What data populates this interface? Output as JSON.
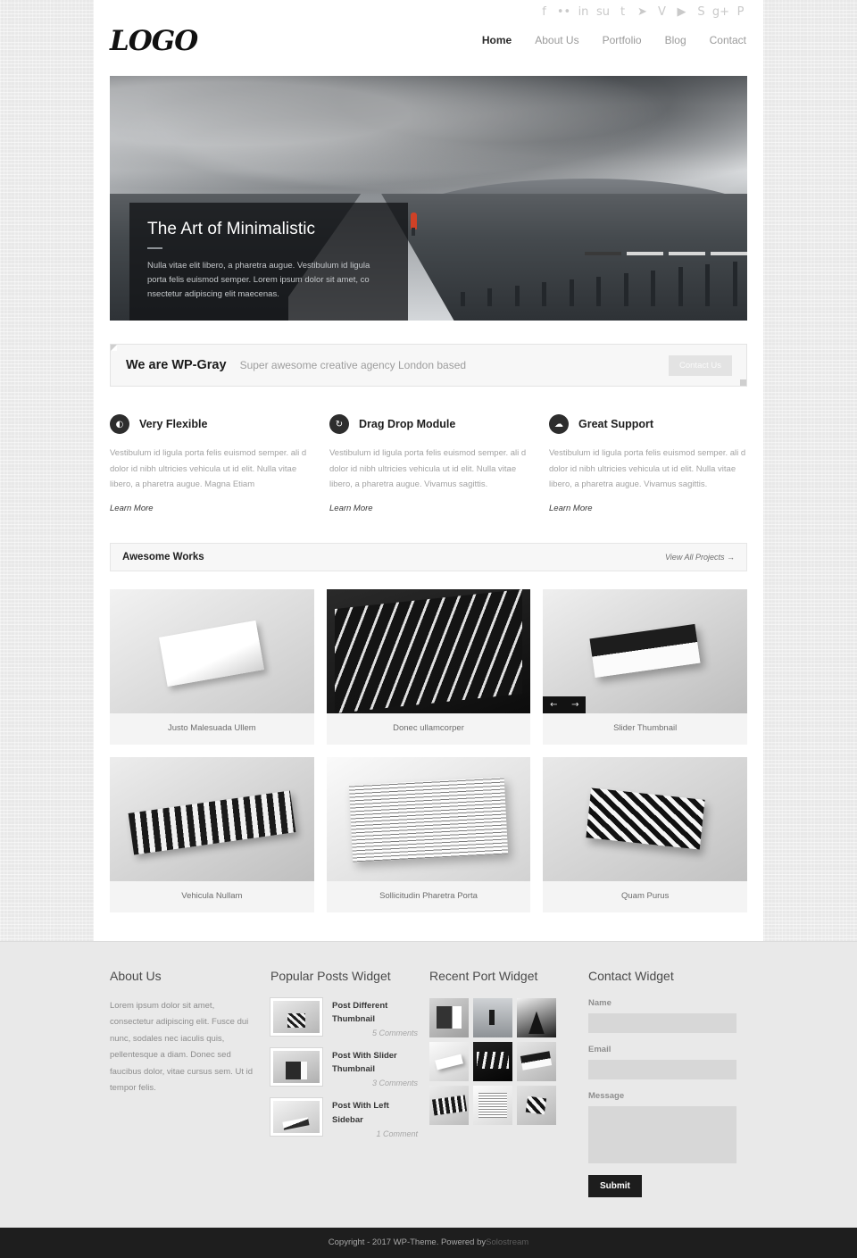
{
  "header": {
    "logo": "LOGO",
    "social": [
      {
        "name": "facebook-icon",
        "glyph": "f"
      },
      {
        "name": "flickr-icon",
        "glyph": "••"
      },
      {
        "name": "linkedin-icon",
        "glyph": "in"
      },
      {
        "name": "stumbleupon-icon",
        "glyph": "su"
      },
      {
        "name": "tumblr-icon",
        "glyph": "t"
      },
      {
        "name": "twitter-icon",
        "glyph": "➤"
      },
      {
        "name": "vimeo-icon",
        "glyph": "V"
      },
      {
        "name": "youtube-icon",
        "glyph": "▶"
      },
      {
        "name": "skype-icon",
        "glyph": "S"
      },
      {
        "name": "googleplus-icon",
        "glyph": "g+"
      },
      {
        "name": "pinterest-icon",
        "glyph": "P"
      }
    ],
    "nav": [
      {
        "label": "Home",
        "active": true
      },
      {
        "label": "About Us",
        "active": false
      },
      {
        "label": "Portfolio",
        "active": false
      },
      {
        "label": "Blog",
        "active": false
      },
      {
        "label": "Contact",
        "active": false
      }
    ]
  },
  "hero": {
    "title": "The Art of Minimalistic",
    "body": "Nulla vitae elit libero, a pharetra augue. Vestibulum id ligula porta felis euismod semper. Lorem ipsum dolor sit amet, co nsectetur adipiscing elit maecenas.",
    "slides": 4,
    "active_slide": 1
  },
  "callout": {
    "title": "We are WP-Gray",
    "subtitle": "Super awesome creative agency London based",
    "button": "Contact Us"
  },
  "features": [
    {
      "icon": "contrast-icon",
      "glyph": "◐",
      "title": "Very Flexible",
      "body": "Vestibulum id ligula porta felis euismod semper. ali d dolor id nibh ultricies vehicula ut id elit. Nulla vitae libero, a pharetra augue. Magna Etiam",
      "link": "Learn More"
    },
    {
      "icon": "refresh-icon",
      "glyph": "↻",
      "title": "Drag Drop Module",
      "body": "Vestibulum id ligula porta felis euismod semper. ali d dolor id nibh ultricies vehicula ut id elit. Nulla vitae libero, a pharetra augue. Vivamus sagittis.",
      "link": "Learn More"
    },
    {
      "icon": "cloud-icon",
      "glyph": "☁",
      "title": "Great Support",
      "body": "Vestibulum id ligula porta felis euismod semper. ali d dolor id nibh ultricies vehicula ut id elit. Nulla vitae libero, a pharetra augue. Vivamus sagittis.",
      "link": "Learn More"
    }
  ],
  "works": {
    "title": "Awesome Works",
    "view_all": "View All Projects →",
    "items": [
      {
        "caption": "Justo Malesuada Ullem",
        "art": "t1",
        "has_arrows": false
      },
      {
        "caption": "Donec ullamcorper",
        "art": "t2",
        "has_arrows": false
      },
      {
        "caption": "Slider Thumbnail",
        "art": "t3",
        "has_arrows": true
      },
      {
        "caption": "Vehicula Nullam",
        "art": "t4",
        "has_arrows": false
      },
      {
        "caption": "Sollicitudin Pharetra Porta",
        "art": "t5",
        "has_arrows": false
      },
      {
        "caption": "Quam Purus",
        "art": "t6",
        "has_arrows": false
      }
    ],
    "arrow_prev": "←",
    "arrow_next": "→"
  },
  "footer": {
    "about": {
      "title": "About Us",
      "body": "Lorem ipsum dolor sit amet, consectetur adipiscing elit. Fusce dui nunc, sodales nec iaculis quis, pellentesque a diam. Donec sed faucibus dolor, vitae cursus sem. Ut id tempor felis."
    },
    "popular_posts": {
      "title": "Popular Posts Widget",
      "items": [
        {
          "title": "Post Different Thumbnail",
          "comments": "5 Comments",
          "art": "pt1"
        },
        {
          "title": "Post With Slider Thumbnail",
          "comments": "3 Comments",
          "art": "pt2"
        },
        {
          "title": "Post With Left Sidebar",
          "comments": "1 Comment",
          "art": "pt3"
        }
      ]
    },
    "recent_port": {
      "title": "Recent Port Widget",
      "cells": [
        "g1",
        "g2",
        "g3",
        "g4",
        "g5",
        "g6",
        "g7",
        "g8",
        "g9"
      ]
    },
    "contact": {
      "title": "Contact Widget",
      "name_label": "Name",
      "name_value": "",
      "name_placeholder": "",
      "email_label": "Email",
      "email_value": "",
      "email_placeholder": "",
      "message_label": "Message",
      "message_value": "",
      "message_placeholder": "",
      "submit": "Submit"
    }
  },
  "copyright": {
    "text": "Copyright - 2017 WP-Theme. Powered by ",
    "link": "Solostream"
  },
  "colors": {
    "accent": "#1d1d1d",
    "page_bg": "#e8e8e8",
    "footer_bg": "#e9e9e9",
    "copyright_bg": "#1e1e1e",
    "muted_text": "#a2a2a2"
  }
}
